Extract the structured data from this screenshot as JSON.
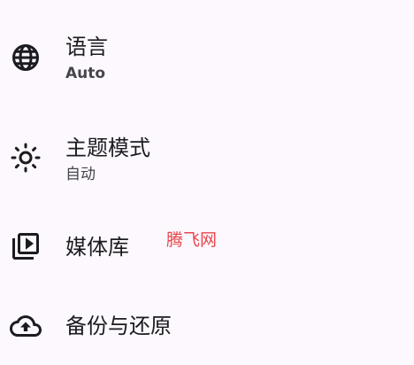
{
  "settings": {
    "language": {
      "title": "语言",
      "value": "Auto",
      "icon": "globe-icon"
    },
    "theme_mode": {
      "title": "主题模式",
      "value": "自动",
      "icon": "sun-icon"
    },
    "media_library": {
      "title": "媒体库",
      "icon": "video-library-icon"
    },
    "backup_restore": {
      "title": "备份与还原",
      "icon": "cloud-upload-icon"
    }
  },
  "watermark": {
    "text": "腾飞网"
  },
  "colors": {
    "background": "#fcf8fd",
    "text": "#1c1b1f",
    "subtext": "#46444d",
    "watermark": "#e8454c"
  }
}
